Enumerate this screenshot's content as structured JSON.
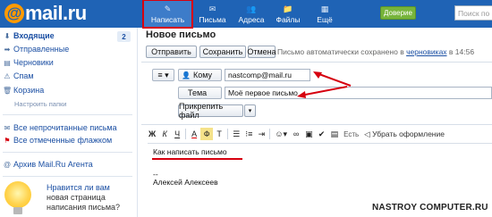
{
  "topbar": {
    "logo_at": "@",
    "logo_text": "mail.ru",
    "nav": [
      {
        "label": "Написать",
        "icon": "✎"
      },
      {
        "label": "Письма",
        "icon": "✉"
      },
      {
        "label": "Адреса",
        "icon": "👥"
      },
      {
        "label": "Файлы",
        "icon": "📁"
      },
      {
        "label": "Ещё",
        "icon": "▦"
      }
    ],
    "green_button": "Доверие",
    "search_placeholder": "Поиск по почте"
  },
  "sidebar": {
    "items": [
      {
        "label": "Входящие",
        "icon": "⬇"
      },
      {
        "label": "Отправленные",
        "icon": "➡"
      },
      {
        "label": "Черновики",
        "icon": "▤"
      },
      {
        "label": "Спам",
        "icon": "⚠"
      },
      {
        "label": "Корзина",
        "icon": "🗑"
      }
    ],
    "inbox_count": "2",
    "folder_settings": "Настроить папки",
    "filters": [
      {
        "label": "Все непрочитанные письма",
        "icon": "✉"
      },
      {
        "label": "Все отмеченные флажком",
        "icon": "⚑"
      }
    ],
    "agent": {
      "label": "Архив Mail.Ru Агента",
      "icon": "@"
    },
    "promo_lines": [
      "Нравится ли вам",
      "новая страница",
      "написания письма?"
    ]
  },
  "main": {
    "title": "Новое письмо",
    "buttons": {
      "send": "Отправить",
      "save": "Сохранить",
      "cancel": "Отмена"
    },
    "autosave_prefix": "Письмо автоматически сохранено в",
    "autosave_link": "черновиках",
    "autosave_time": "в 14:56",
    "to_label": "Кому",
    "to_value": "nastcomp@mail.ru",
    "subject_label": "Тема",
    "subject_value": "Моё первое письмо",
    "attach_button": "Прикрепить файл",
    "toolbar": {
      "bold": "Ж",
      "italic": "К",
      "underline": "Ч",
      "text_color": "А",
      "bg_color": "Ф",
      "font": "Т",
      "spell": "Есть",
      "remove_format": "◁ Убрать оформление"
    },
    "body": {
      "line1": "Как написать письмо",
      "sig_dash": "--",
      "sig_name": "Алексей Алексеев"
    }
  },
  "watermark": "NASTROY COMPUTER.RU",
  "colors": {
    "topbar": "#1f63b5",
    "accent_red": "#d6000f",
    "link": "#1b4fa3",
    "green": "#77b43b"
  }
}
